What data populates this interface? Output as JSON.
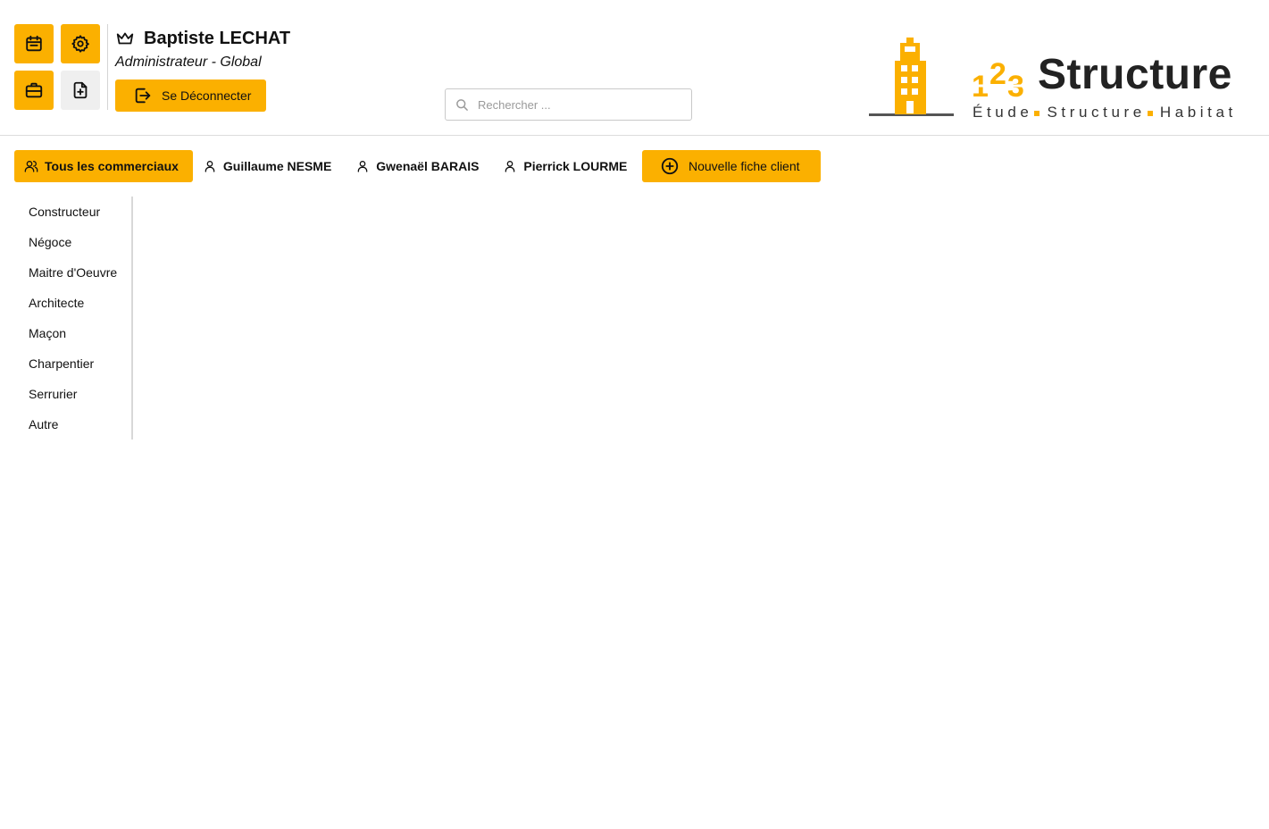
{
  "header": {
    "user": {
      "name": "Baptiste LECHAT",
      "role": "Administrateur - Global"
    },
    "logout_label": "Se Déconnecter",
    "search": {
      "placeholder": "Rechercher ..."
    },
    "quick_buttons": [
      {
        "icon": "calendar-icon"
      },
      {
        "icon": "gear-icon"
      },
      {
        "icon": "briefcase-icon"
      },
      {
        "icon": "file-plus-icon"
      }
    ],
    "logo": {
      "brand": "Structure",
      "numeral": "123",
      "tagline": [
        "Étude",
        "Structure",
        "Habitat"
      ]
    }
  },
  "tabs": [
    {
      "label": "Tous les commerciaux",
      "icon": "users-icon",
      "active": true
    },
    {
      "label": "Guillaume NESME",
      "icon": "user-icon",
      "active": false
    },
    {
      "label": "Gwenaël BARAIS",
      "icon": "user-icon",
      "active": false
    },
    {
      "label": "Pierrick LOURME",
      "icon": "user-icon",
      "active": false
    }
  ],
  "new_client_label": "Nouvelle fiche client",
  "sidebar": {
    "items": [
      {
        "label": "Constructeur"
      },
      {
        "label": "Négoce"
      },
      {
        "label": "Maitre d'Oeuvre"
      },
      {
        "label": "Architecte"
      },
      {
        "label": "Maçon"
      },
      {
        "label": "Charpentier"
      },
      {
        "label": "Serrurier"
      },
      {
        "label": "Autre"
      }
    ]
  },
  "colors": {
    "accent": "#fbb000",
    "button_grey": "#efefef",
    "text": "#111111",
    "logo_dark": "#222222"
  }
}
